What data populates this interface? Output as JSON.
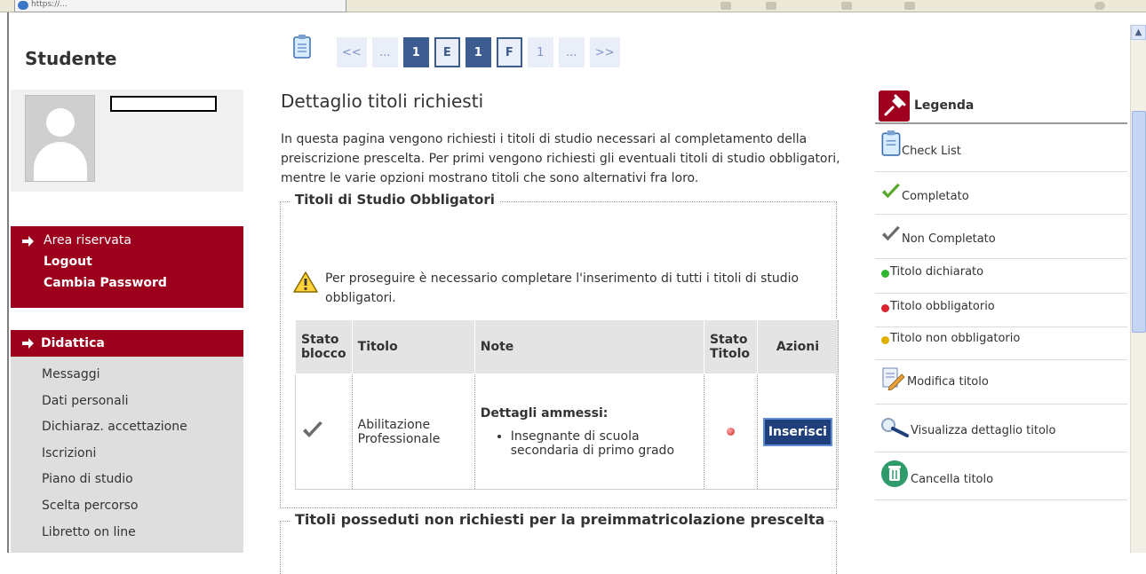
{
  "browser": {
    "url_fragment": "https://...",
    "scroll_up_glyph": "▲"
  },
  "sidebar": {
    "title": "Studente",
    "area_menu": {
      "head": "Area riservata",
      "items": [
        "Logout",
        "Cambia Password"
      ]
    },
    "didattica": {
      "head": "Didattica",
      "items": [
        "Messaggi",
        "Dati personali",
        "Dichiaraz. accettazione",
        "Iscrizioni",
        "Piano di studio",
        "Scelta percorso",
        "Libretto on line"
      ]
    }
  },
  "pager": {
    "items": [
      {
        "label": "<<",
        "style": "link"
      },
      {
        "label": "...",
        "style": "link"
      },
      {
        "label": "1",
        "style": "active"
      },
      {
        "label": "E",
        "style": "framed"
      },
      {
        "label": "1",
        "style": "active"
      },
      {
        "label": "F",
        "style": "framed"
      },
      {
        "label": "1",
        "style": "link"
      },
      {
        "label": "...",
        "style": "link"
      },
      {
        "label": ">>",
        "style": "link"
      }
    ]
  },
  "main": {
    "title": "Dettaglio titoli richiesti",
    "intro": "In questa pagina vengono richiesti i titoli di studio necessari al completamento della preiscrizione prescelta. Per primi vengono richiesti gli eventuali titoli di studio obbligatori, mentre le varie opzioni mostrano titoli che sono alternativi fra loro.",
    "section_obbligatori": {
      "legend": "Titoli di Studio Obbligatori",
      "warning": "Per proseguire è necessario completare l'inserimento di tutti i titoli di studio obbligatori.",
      "table": {
        "headers": {
          "stato_blocco": "Stato blocco",
          "titolo": "Titolo",
          "note": "Note",
          "stato_titolo": "Stato Titolo",
          "azioni": "Azioni"
        },
        "row": {
          "titolo": "Abilitazione Professionale",
          "note_heading": "Dettagli ammessi:",
          "note_item": "Insegnante di scuola secondaria di primo grado",
          "action_label": "Inserisci"
        }
      }
    },
    "section_posseduti": {
      "legend": "Titoli posseduti non richiesti per la preimmatricolazione prescelta"
    }
  },
  "legend": {
    "title": "Legenda",
    "items": [
      "Check List",
      "Completato",
      "Non Completato",
      "Titolo dichiarato",
      "Titolo obbligatorio",
      "Titolo non obbligatorio",
      "Modifica titolo",
      "Visualizza dettaglio titolo",
      "Cancella titolo"
    ],
    "colors": {
      "completed_check": "#5aa82a",
      "not_completed_check": "#6b6b6b",
      "dot_declared": "#2fb52f",
      "dot_required": "#d9232d",
      "dot_optional": "#e0b000"
    }
  },
  "colors": {
    "brand_red": "#9d001c",
    "pager_blue": "#3d5c8f",
    "button_blue": "#1e3f7a"
  }
}
